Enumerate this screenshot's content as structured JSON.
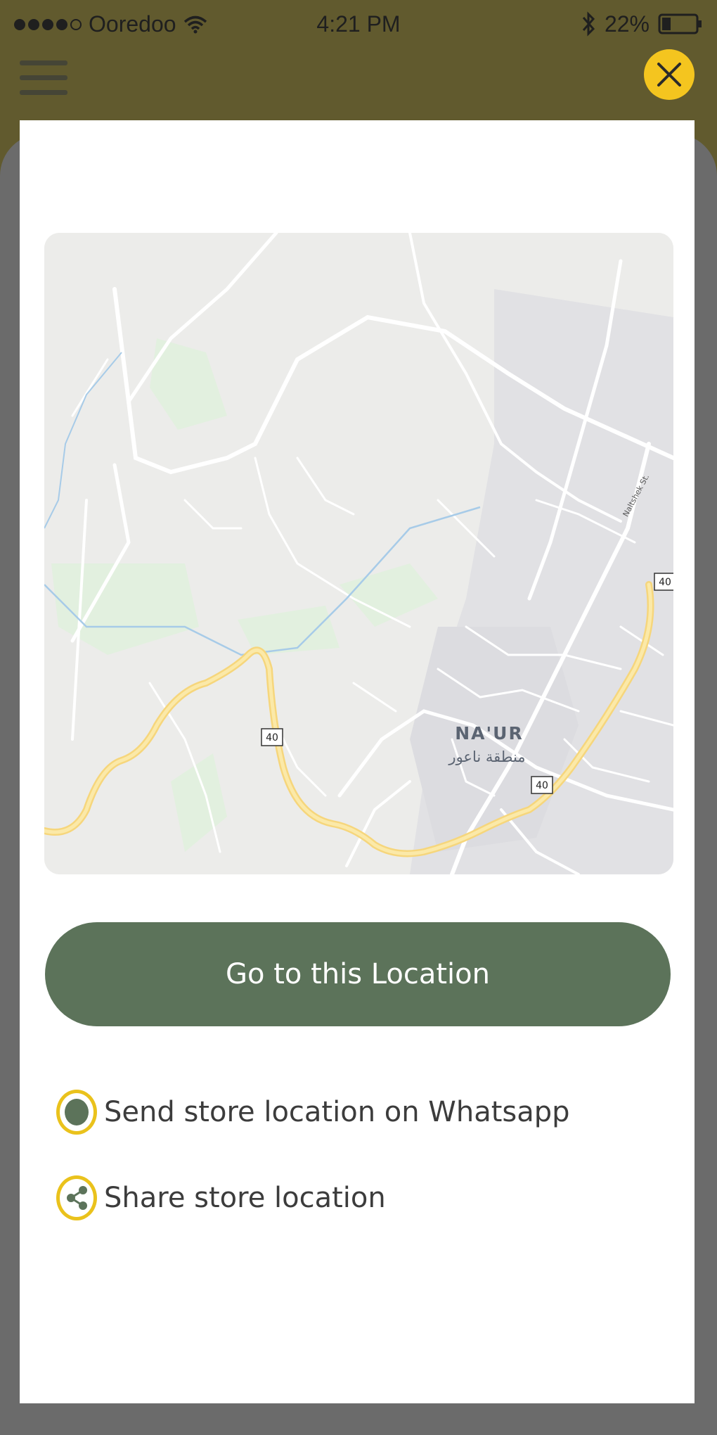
{
  "status_bar": {
    "carrier": "Ooredoo",
    "time": "4:21 PM",
    "battery": "22%"
  },
  "icons": {
    "menu": "hamburger-menu-icon",
    "close": "close-icon",
    "whatsapp": "whatsapp-icon",
    "share": "share-icon"
  },
  "colors": {
    "header": "#615a2e",
    "accent_yellow": "#f4c51f",
    "primary_green": "#5c735a"
  },
  "map": {
    "place_name": "NA'UR",
    "place_name_arabic": "منطقة ناعور",
    "street_label": "Naltshek St.",
    "route_labels": [
      "40",
      "40",
      "40"
    ]
  },
  "actions": {
    "go_button": "Go to this Location",
    "whatsapp_option": "Send store location on Whatsapp",
    "share_option": "Share store location"
  }
}
